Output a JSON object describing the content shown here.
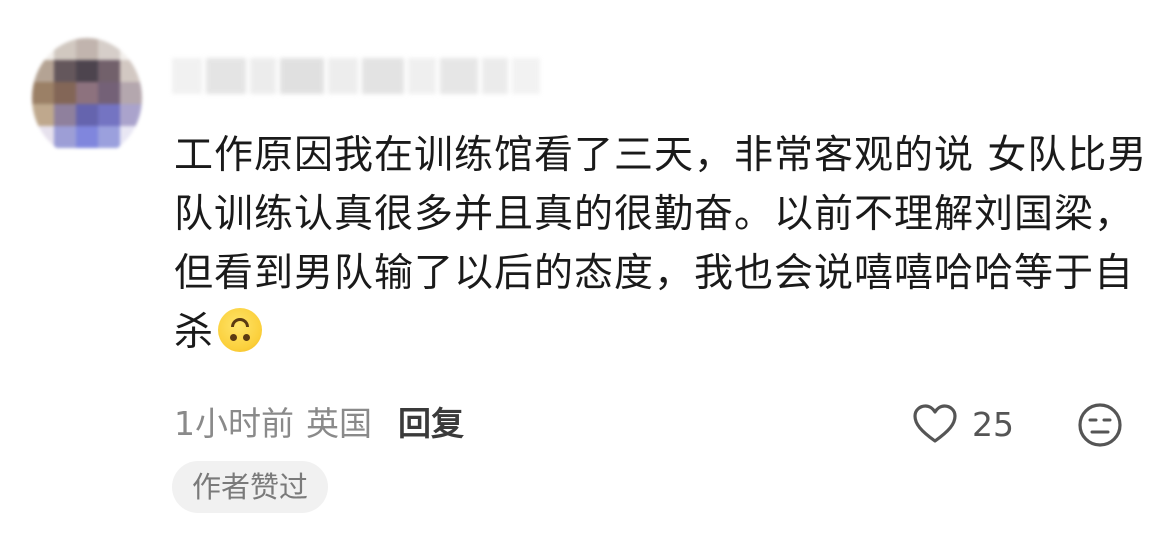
{
  "comment": {
    "author": {
      "avatar_icon": "avatar-blurred",
      "username_icon": "username-blurred"
    },
    "text": "工作原因我在训练馆看了三天，非常客观的说 女队比男队训练认真很多并且真的很勤奋。以前不理解刘国梁，但看到男队输了以后的态度，我也会说嘻嘻哈哈等于自杀",
    "emoji_icon": "upside-down-face-emoji",
    "time": "1小时前",
    "location": "英国",
    "reply_label": "回复",
    "like_icon": "heart-outline-icon",
    "like_count": "25",
    "dislike_icon": "unamused-face-icon",
    "author_liked_badge": "作者赞过"
  },
  "colors": {
    "text": "#1a1a1a",
    "meta": "#8a8a8a",
    "badge_bg": "#f1f1f1",
    "emoji": "#fbd03c"
  }
}
